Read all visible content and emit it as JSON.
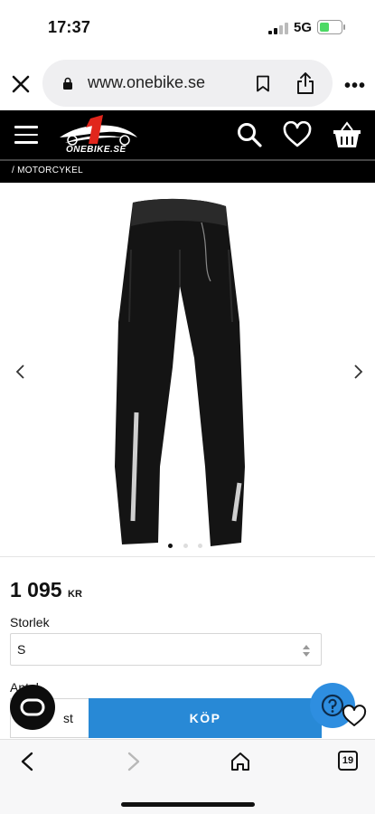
{
  "status_bar": {
    "time": "17:37",
    "network": "5G"
  },
  "browser": {
    "url": "www.onebike.se",
    "tab_count": "19"
  },
  "site": {
    "logo_text": "ONEBIKE.SE",
    "breadcrumb": "/ MOTORCYKEL"
  },
  "product": {
    "price": "1 095",
    "currency": "KR",
    "size_label": "Storlek",
    "size_value": "S",
    "qty_label": "Antal",
    "qty_unit": "st",
    "buy_label": "KÖP",
    "image_count": 3,
    "active_image": 1
  },
  "colors": {
    "header_bg": "#000000",
    "buy_button": "#2889d6",
    "help_fab": "#2e8ee0",
    "logo_red": "#e1261c"
  },
  "icons": [
    "close-icon",
    "lock-icon",
    "bookmark-icon",
    "share-icon",
    "more-icon",
    "menu-icon",
    "search-icon",
    "heart-icon",
    "basket-icon",
    "chevron-left-icon",
    "chevron-right-icon",
    "sort-icon",
    "chat-icon",
    "help-icon",
    "back-icon",
    "forward-icon",
    "home-icon",
    "tabs-icon"
  ]
}
